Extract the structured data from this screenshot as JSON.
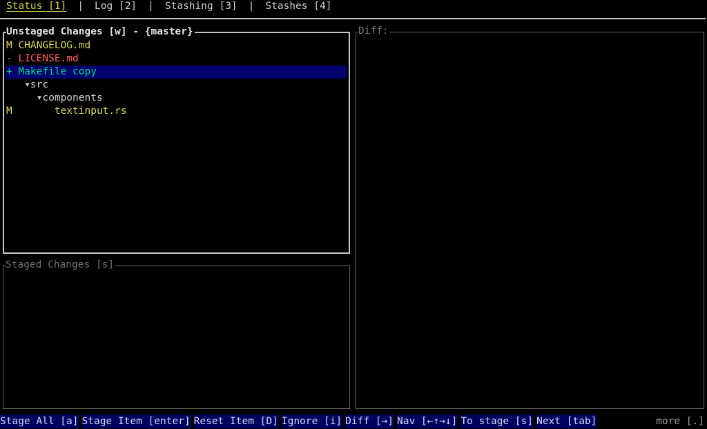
{
  "tabs": [
    {
      "label": "Status [1]",
      "active": true
    },
    {
      "label": "Log [2]"
    },
    {
      "label": "Stashing [3]"
    },
    {
      "label": "Stashes [4]"
    }
  ],
  "tab_separator": "|",
  "unstaged": {
    "title": "Unstaged Changes [w] - {master}",
    "items": [
      {
        "status": "M",
        "name": "CHANGELOG.md",
        "color": "#d7d75f"
      },
      {
        "status": "-",
        "name": "LICENSE.md",
        "color": "#ff5f5f"
      },
      {
        "status": "+",
        "name": "Makefile copy",
        "color": "#00d787",
        "selected": true
      },
      {
        "status": "",
        "name": "  ▾src",
        "color": "#d0d0d0"
      },
      {
        "status": "",
        "name": "    ▾components",
        "color": "#d0d0d0"
      },
      {
        "status": "M",
        "name": "      textinput.rs",
        "color": "#d7d75f"
      }
    ]
  },
  "staged": {
    "title": "Staged Changes [s]"
  },
  "diff": {
    "title": "Diff:"
  },
  "footer": {
    "commands": [
      "Stage All [a]",
      "Stage Item [enter]",
      "Reset Item [D]",
      "Ignore [i]",
      "Diff [→]",
      "Nav [←↑→↓]",
      "To stage [s]",
      "Next [tab]"
    ],
    "more": "more [.]"
  },
  "colors": {
    "selection": "#00006e",
    "command_bg": "#00005f",
    "modified": "#d7d75f",
    "deleted": "#ff5f5f",
    "added": "#00d787"
  }
}
